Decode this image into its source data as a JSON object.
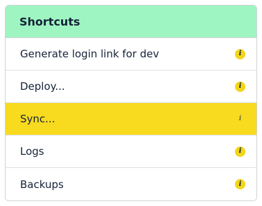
{
  "header": {
    "title": "Shortcuts"
  },
  "items": [
    {
      "label": "Generate login link for dev",
      "icon": "info-icon",
      "icon_glyph": "i"
    },
    {
      "label": "Deploy...",
      "icon": "info-icon",
      "icon_glyph": "i"
    },
    {
      "label": "Sync...",
      "icon": "info-icon",
      "icon_glyph": "i",
      "active": true
    },
    {
      "label": "Logs",
      "icon": "info-icon",
      "icon_glyph": "i"
    },
    {
      "label": "Backups",
      "icon": "info-icon",
      "icon_glyph": "i"
    }
  ],
  "colors": {
    "header_bg": "#9ef5c2",
    "active_bg": "#f8da1f",
    "icon_bg": "#f2d51b",
    "text": "#152238"
  }
}
